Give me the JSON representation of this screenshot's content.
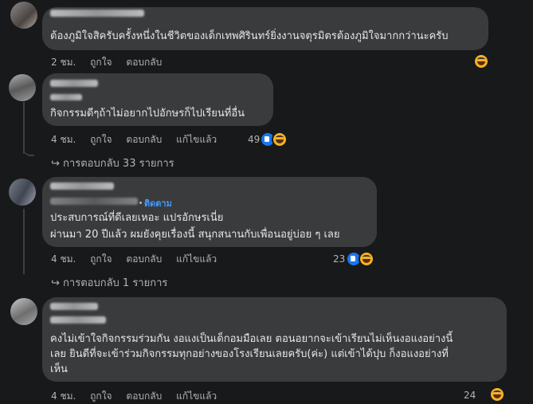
{
  "comments": [
    {
      "text_lines": [
        "ต้องภูมิใจสิครับครั้งหนึ่งในชีวิตของเด็กเทพศิรินทร์ยิ่งงานจตุรมิตรต้องภูมิใจมากกว่านะครับ"
      ],
      "time": "2 ชม.",
      "like_label": "ถูกใจ",
      "reply_label": "ตอบกลับ",
      "reactions": [
        "haha-icon"
      ]
    },
    {
      "text_lines": [
        "กิจกรรมดีๆถ้าไม่อยากไปอักษรก็ไปเรียนที่อื่น"
      ],
      "time": "4 ชม.",
      "like_label": "ถูกใจ",
      "reply_label": "ตอบกลับ",
      "edited_label": "แก้ไขแล้ว",
      "reaction_count": "49",
      "reactions": [
        "like-icon",
        "haha-icon"
      ],
      "replies_label": "การตอบกลับ 33 รายการ"
    },
    {
      "follow_label": "ติดตาม",
      "text_lines": [
        "ประสบการณ์ที่ดีเลยเหอะ แปรอักษรเนี่ย",
        "ผ่านมา 20 ปีแล้ว ผมยังคุยเรื่องนี้ สนุกสนานกับเพื่อนอยู่บ่อย ๆ เลย"
      ],
      "time": "4 ชม.",
      "like_label": "ถูกใจ",
      "reply_label": "ตอบกลับ",
      "edited_label": "แก้ไขแล้ว",
      "reaction_count": "23",
      "reactions": [
        "like-icon",
        "haha-icon"
      ],
      "replies_label": "การตอบกลับ 1 รายการ"
    },
    {
      "text_lines": [
        "คงไม่เข้าใจกิจกรรมร่วมกัน งอแงเป็นเด็กอมมือเลย ตอนอยากจะเข้าเรียนไม่เห็นงอแงอย่างนี้",
        "เลย ยินดีที่จะเข้าร่วมกิจกรรมทุกอย่างของโรงเรียนเลยครับ(ค่ะ) แต่เข้าได้ปุบ ก็งอแงอย่างที่",
        "เห็น"
      ],
      "time": "4 ชม.",
      "like_label": "ถูกใจ",
      "reply_label": "ตอบกลับ",
      "edited_label": "แก้ไขแล้ว",
      "reaction_count": "24",
      "reactions": [
        "haha-icon"
      ]
    }
  ],
  "colors": {
    "background": "#18191a",
    "bubble": "#3a3b3c",
    "text": "#e4e6eb",
    "muted": "#b0b3b8",
    "link": "#4599ff"
  }
}
